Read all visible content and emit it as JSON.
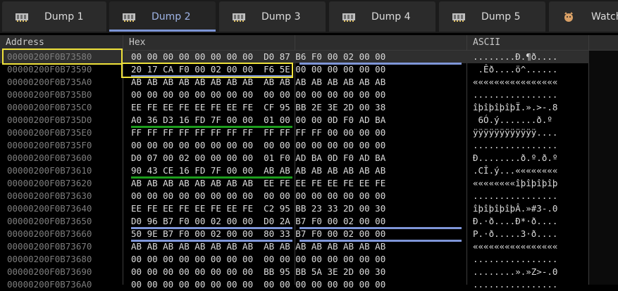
{
  "tabs": [
    {
      "label": "Dump 1",
      "icon": "memory-icon",
      "active": false
    },
    {
      "label": "Dump 2",
      "icon": "memory-icon",
      "active": true
    },
    {
      "label": "Dump 3",
      "icon": "memory-icon",
      "active": false
    },
    {
      "label": "Dump 4",
      "icon": "memory-icon",
      "active": false
    },
    {
      "label": "Dump 5",
      "icon": "memory-icon",
      "active": false
    },
    {
      "label": "Watch",
      "icon": "watch-icon",
      "active": false
    }
  ],
  "columns": {
    "address": "Address",
    "hex": "Hex",
    "ascii": "ASCII"
  },
  "rows": [
    {
      "address": "00000200F0B73580",
      "hex": "00 00 00 00 00 00 00 00 D0 87 B6 F0 00 02 00 00",
      "ascii": "........Ð.¶ð...."
    },
    {
      "address": "00000200F0B73590",
      "hex": "20 17 CA F0 00 02 00 00 F6 5E 00 00 00 00 00 00",
      "ascii": " .Êð....ö^......"
    },
    {
      "address": "00000200F0B735A0",
      "hex": "AB AB AB AB AB AB AB AB AB AB AB AB AB AB AB AB",
      "ascii": "««««««««««««««««"
    },
    {
      "address": "00000200F0B735B0",
      "hex": "00 00 00 00 00 00 00 00 00 00 00 00 00 00 00 00",
      "ascii": "................"
    },
    {
      "address": "00000200F0B735C0",
      "hex": "EE FE EE FE EE FE EE FE CF 95 BB 2E 3E 2D 00 38",
      "ascii": "îþîþîþîþÏ.».>-.8"
    },
    {
      "address": "00000200F0B735D0",
      "hex": "A0 36 D3 16 FD 7F 00 00 01 00 00 00 0D F0 AD BA",
      "ascii": " 6Ó.ý.......ð.º"
    },
    {
      "address": "00000200F0B735E0",
      "hex": "FF FF FF FF FF FF FF FF FF FF FF FF 00 00 00 00",
      "ascii": "ÿÿÿÿÿÿÿÿÿÿÿÿ...."
    },
    {
      "address": "00000200F0B735F0",
      "hex": "00 00 00 00 00 00 00 00 00 00 00 00 00 00 00 00",
      "ascii": "................"
    },
    {
      "address": "00000200F0B73600",
      "hex": "D0 07 00 02 00 00 00 00 01 F0 AD BA 0D F0 AD BA",
      "ascii": "Ð........ð.º.ð.º"
    },
    {
      "address": "00000200F0B73610",
      "hex": "90 43 CE 16 FD 7F 00 00 AB AB AB AB AB AB AB AB",
      "ascii": ".CÎ.ý...««««««««"
    },
    {
      "address": "00000200F0B73620",
      "hex": "AB AB AB AB AB AB AB AB EE FE EE FE EE FE EE FE",
      "ascii": "««««««««îþîþîþîþ"
    },
    {
      "address": "00000200F0B73630",
      "hex": "00 00 00 00 00 00 00 00 00 00 00 00 00 00 00 00",
      "ascii": "................"
    },
    {
      "address": "00000200F0B73640",
      "hex": "EE FE EE FE EE FE EE FE C2 95 BB 23 33 2D 00 30",
      "ascii": "îþîþîþîþÂ.»#3-.0"
    },
    {
      "address": "00000200F0B73650",
      "hex": "D0 96 B7 F0 00 02 00 00 D0 2A B7 F0 00 02 00 00",
      "ascii": "Ð.·ð....Ð*·ð...."
    },
    {
      "address": "00000200F0B73660",
      "hex": "50 9E B7 F0 00 02 00 00 80 33 B7 F0 00 02 00 00",
      "ascii": "P.·ð.....3·ð...."
    },
    {
      "address": "00000200F0B73670",
      "hex": "AB AB AB AB AB AB AB AB AB AB AB AB AB AB AB AB",
      "ascii": "««««««««««««««««"
    },
    {
      "address": "00000200F0B73680",
      "hex": "00 00 00 00 00 00 00 00 00 00 00 00 00 00 00 00",
      "ascii": "................"
    },
    {
      "address": "00000200F0B73690",
      "hex": "00 00 00 00 00 00 00 00 BB 95 BB 5A 3E 2D 00 30",
      "ascii": "........».»Z>-.0"
    },
    {
      "address": "00000200F0B736A0",
      "hex": "00 00 00 00 00 00 00 00 00 00 00 00 00 00 00 00",
      "ascii": "................"
    }
  ],
  "colors": {
    "pointer_underline": "#7f96d8",
    "code_pointer_underline": "#1c9c1c",
    "highlight_box": "#f0e23a"
  }
}
